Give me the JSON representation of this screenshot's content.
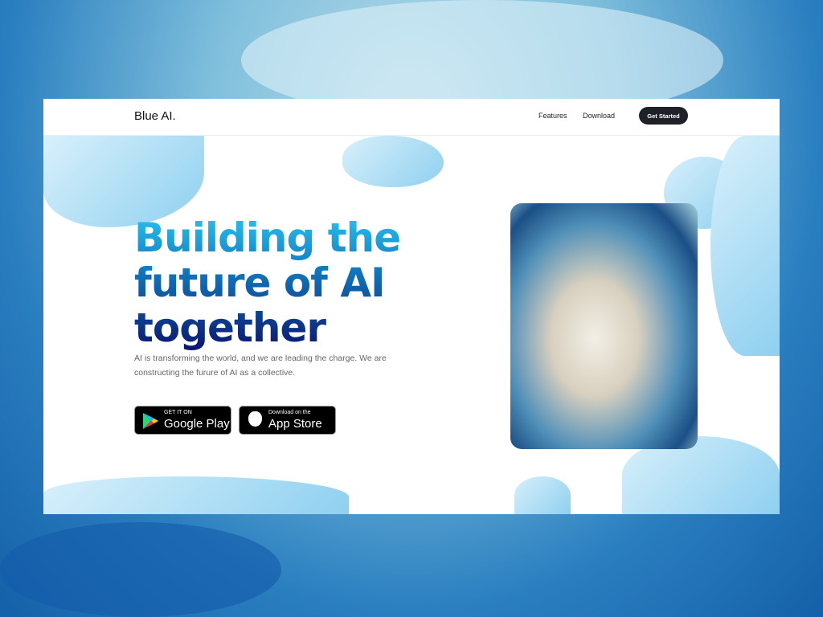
{
  "nav": {
    "logo": "Blue AI.",
    "links": [
      "Features",
      "Download"
    ],
    "cta": "Get Started"
  },
  "hero": {
    "title_lines": [
      "Building the",
      "future of AI",
      "together"
    ],
    "description": "AI is transforming the world, and we are leading the charge. We are constructing the furure of AI as a collective.",
    "google_play": {
      "small": "GET IT ON",
      "large": "Google Play"
    },
    "app_store": {
      "small": "Download on the",
      "large": "App Store"
    },
    "image": "leopard-illustration"
  },
  "colors": {
    "accent_start": "#25c3f0",
    "accent_end": "#0b1670",
    "cta_bg": "#1e2228"
  }
}
